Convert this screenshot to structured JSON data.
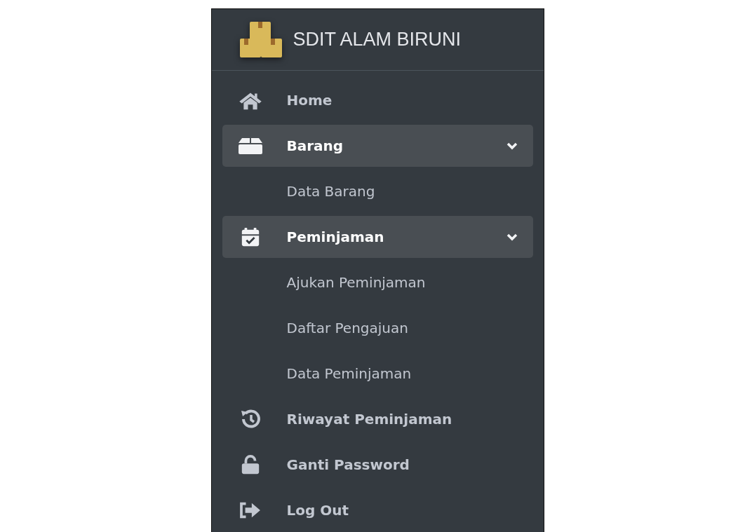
{
  "sidebar": {
    "brand": {
      "title": "SDIT ALAM BIRUNI"
    },
    "items": [
      {
        "kind": "link",
        "label": "Home"
      },
      {
        "kind": "tree",
        "label": "Barang",
        "expanded": true,
        "children": [
          {
            "label": "Data Barang"
          }
        ]
      },
      {
        "kind": "tree",
        "label": "Peminjaman",
        "expanded": true,
        "children": [
          {
            "label": "Ajukan Peminjaman"
          },
          {
            "label": "Daftar Pengajuan"
          },
          {
            "label": "Data Peminjaman"
          }
        ]
      },
      {
        "kind": "link",
        "label": "Riwayat Peminjaman"
      },
      {
        "kind": "link",
        "label": "Ganti Password"
      },
      {
        "kind": "link",
        "label": "Log Out"
      }
    ]
  }
}
